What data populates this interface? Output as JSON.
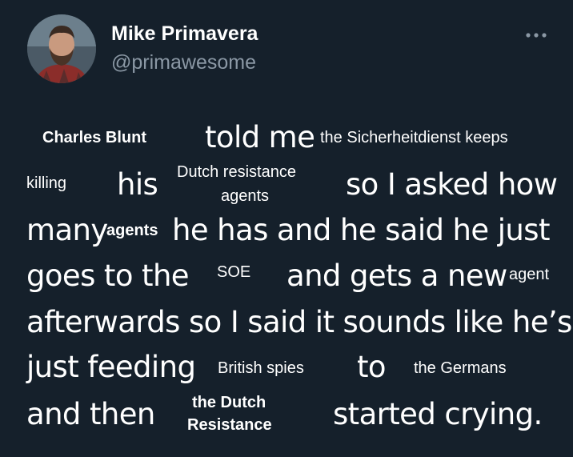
{
  "author": {
    "name": "Mike Primavera",
    "handle": "@primawesome",
    "avatar_icon": "user-avatar-bearded-man"
  },
  "more_icon": "more-options-icon",
  "tweet": {
    "w1": "Charles Blunt",
    "w2": "told me",
    "w3": "the Sicherheitdienst keeps",
    "w4": "killing",
    "w5": "his",
    "w6a": "Dutch resistance",
    "w6b": "agents",
    "w7": "so I asked how",
    "w8": "many",
    "w9": "agents",
    "w10": "he has and he said he just",
    "w11": "goes to the",
    "w12": "SOE",
    "w13": "and gets a new",
    "w14": "agent",
    "w15": "afterwards so I said it sounds like he’s",
    "w16": "just feeding",
    "w17": "British spies",
    "w18": "to",
    "w19": "the Germans",
    "w20": "and then",
    "w21a": "the Dutch",
    "w21b": "Resistance",
    "w22": "started crying."
  }
}
